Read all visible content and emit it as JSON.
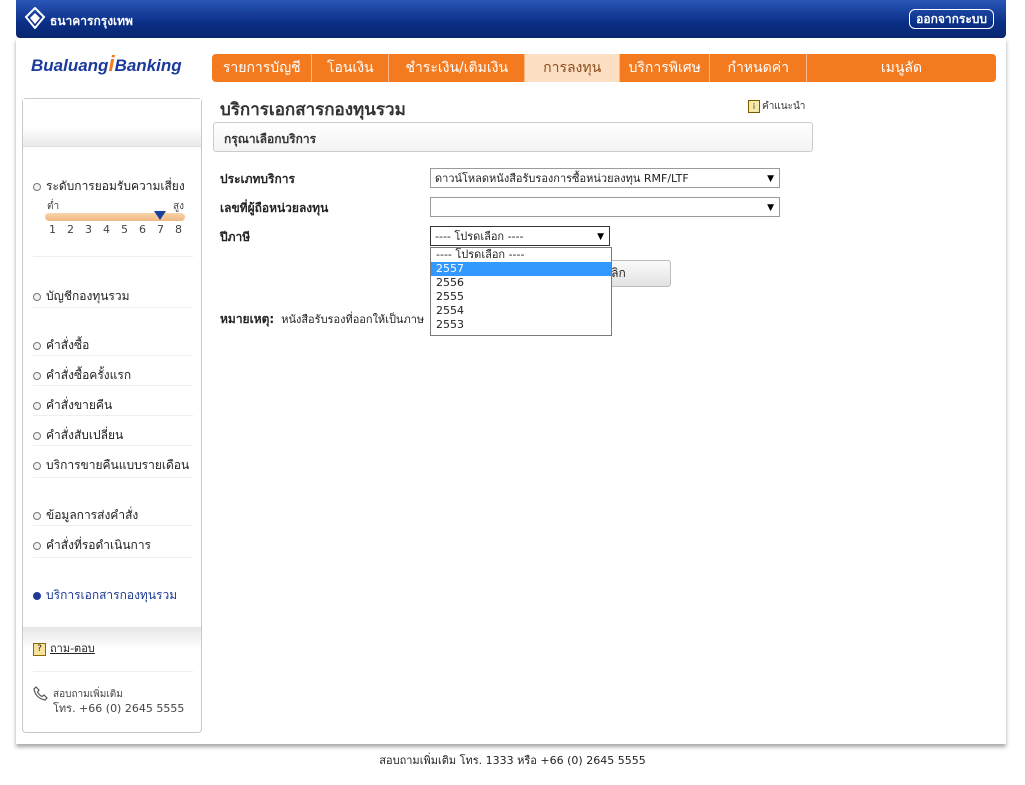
{
  "header": {
    "bank_name": "ธนาคารกรุงเทพ",
    "logout_label": "ออกจากระบบ"
  },
  "brand": {
    "left": "Bualuang",
    "i": "i",
    "right": "Banking"
  },
  "nav": {
    "tabs": [
      {
        "label": "รายการบัญชี"
      },
      {
        "label": "โอนเงิน"
      },
      {
        "label": "ชำระเงิน/เติมเงิน"
      },
      {
        "label": "การลงทุน"
      },
      {
        "label": "บริการพิเศษ"
      },
      {
        "label": "กำหนดค่า"
      },
      {
        "label": "เมนูลัด"
      }
    ],
    "active_tab": "การลงทุน"
  },
  "sidebar": {
    "risk": {
      "label": "ระดับการยอมรับความเสี่ยง",
      "low": "ต่ำ",
      "high": "สูง",
      "scale": [
        "1",
        "2",
        "3",
        "4",
        "5",
        "6",
        "7",
        "8"
      ],
      "level": 7
    },
    "items": [
      {
        "label": "บัญชีกองทุนรวม"
      },
      {
        "label": "คำสั่งซื้อ"
      },
      {
        "label": "คำสั่งซื้อครั้งแรก"
      },
      {
        "label": "คำสั่งขายคืน"
      },
      {
        "label": "คำสั่งสับเปลี่ยน"
      },
      {
        "label": "บริการขายคืนแบบรายเดือน"
      },
      {
        "label": "ข้อมูลการส่งคำสั่ง"
      },
      {
        "label": "คำสั่งที่รอดำเนินการ"
      },
      {
        "label": "บริการเอกสารกองทุนรวม"
      }
    ],
    "faq_label": "ถาม-ตอบ",
    "contact_label": "สอบถามเพิ่มเติม",
    "contact_phone": "โทร. +66 (0) 2645 5555"
  },
  "main": {
    "title": "บริการเอกสารกองทุนรวม",
    "help_label": "คำแนะนำ",
    "panel_title": "กรุณาเลือกบริการ",
    "fields": [
      {
        "label": "ประเภทบริการ",
        "value": "ดาวน์โหลดหนังสือรับรองการซื้อหน่วยลงทุน RMF/LTF"
      },
      {
        "label": "เลขที่ผู้ถือหน่วยลงทุน",
        "value": ""
      },
      {
        "label": "ปีภาษี",
        "value": "---- โปรดเลือก ----"
      }
    ],
    "cancel_fragment": "เลิก",
    "note_label": "หมายเหตุ:",
    "note_text": "หนังสือรับรองที่ออกให้เป็นภาษ",
    "year_options": [
      "---- โปรดเลือก ----",
      "2557",
      "2556",
      "2555",
      "2554",
      "2553"
    ],
    "highlighted_option": "2557"
  },
  "footer": {
    "text": "สอบถามเพิ่มเติม โทร. 1333 หรือ +66 (0) 2645 5555"
  },
  "colors": {
    "nav_orange": "#f47a20",
    "header_blue": "#0a2f86",
    "dropdown_highlight": "#3399ff"
  }
}
